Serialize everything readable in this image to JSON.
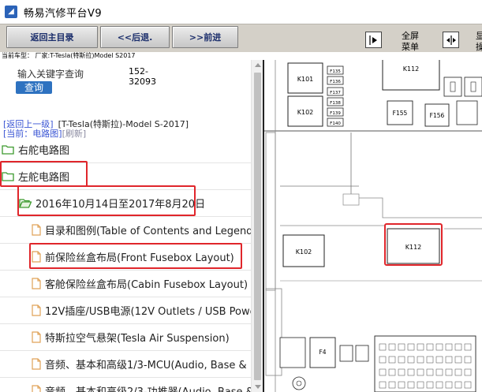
{
  "window": {
    "title": "畅易汽修平台V9"
  },
  "toolbar": {
    "back_main": "返回主目录",
    "back": "<<后退.",
    "forward": ">>前进",
    "fullscreen_line1": "全屏",
    "fullscreen_line2": "菜单",
    "right_line1": "显",
    "right_line2": "操"
  },
  "status": {
    "current_model": "当前车型： 厂家:T-Tesla(特斯拉)Model S2017"
  },
  "search": {
    "label": "输入关键字查询",
    "button": "查询",
    "code_line1": "152-",
    "code_line2": "32093"
  },
  "nav": {
    "up_link": "[返回上一级]",
    "model": "[T-Tesla(特斯拉)-Model S-2017]",
    "current_prefix": "[当前：电路图]",
    "refresh": "[刷新]"
  },
  "tree": {
    "items": [
      {
        "label": "右舵电路图",
        "icon": "folder-icon"
      },
      {
        "label": "左舵电路图",
        "icon": "folder-icon"
      },
      {
        "label": "2016年10月14日至2017年8月20日",
        "icon": "folder-open-icon"
      },
      {
        "label": "目录和图例(Table of Contents and Legend)",
        "icon": "document-icon"
      },
      {
        "label": "前保险丝盒布局(Front Fusebox Layout)",
        "icon": "document-icon"
      },
      {
        "label": "客舱保险丝盒布局(Cabin Fusebox Layout)",
        "icon": "document-icon"
      },
      {
        "label": "12V插座/USB电源(12V Outlets / USB Powe",
        "icon": "document-icon"
      },
      {
        "label": "特斯拉空气悬架(Tesla Air Suspension)",
        "icon": "document-icon"
      },
      {
        "label": "音频、基本和高级1/3-MCU(Audio, Base &",
        "icon": "document-icon"
      },
      {
        "label": "音频、基本和高级2/3-功推器(Audio, Base &",
        "icon": "document-icon"
      }
    ]
  },
  "diagram": {
    "labels": {
      "k101": "K101",
      "k102": "K102",
      "k112_top": "K112",
      "f135": "F135",
      "f136": "F136",
      "f137": "F137",
      "f138": "F138",
      "f139": "F139",
      "f140": "F140",
      "f155": "F155",
      "f156": "F156",
      "k102_mid": "K102",
      "k112_mid": "K112",
      "f4": "F4"
    }
  },
  "colors": {
    "highlight": "#e0262b",
    "link": "#3a55d4",
    "search_button": "#2e72c0",
    "toolbar": "#d4d0c8"
  }
}
